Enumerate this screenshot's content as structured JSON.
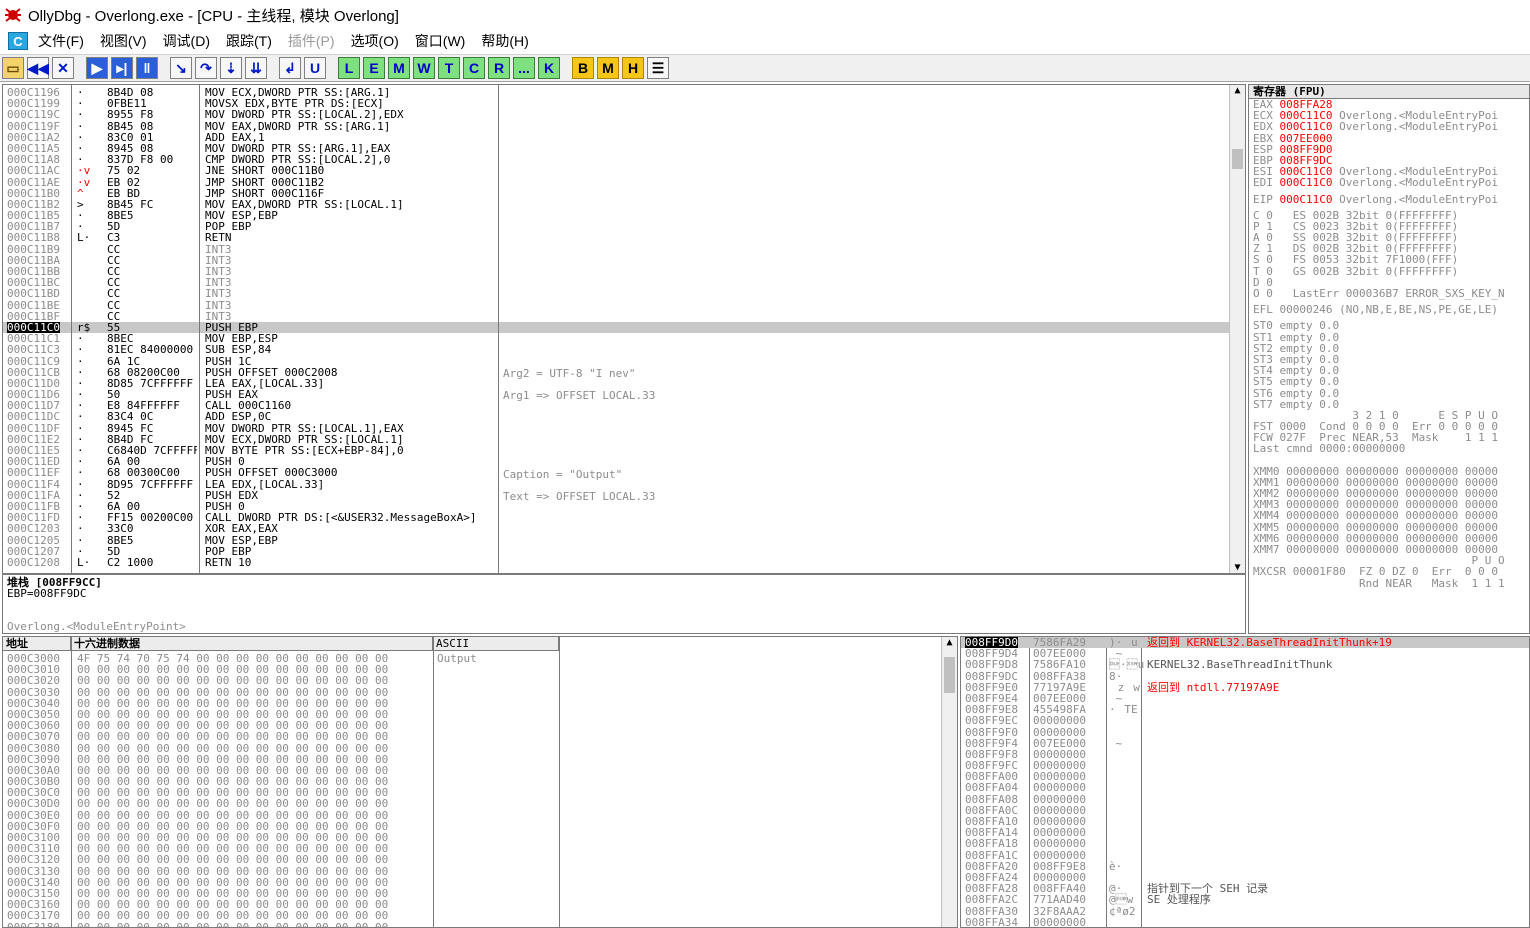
{
  "window": {
    "title": "OllyDbg - Overlong.exe - [CPU - 主线程, 模块 Overlong]"
  },
  "menu": {
    "cpu_icon": "C",
    "items": [
      {
        "label": "文件(F)",
        "enabled": true
      },
      {
        "label": "视图(V)",
        "enabled": true
      },
      {
        "label": "调试(D)",
        "enabled": true
      },
      {
        "label": "跟踪(T)",
        "enabled": true
      },
      {
        "label": "插件(P)",
        "enabled": false
      },
      {
        "label": "选项(O)",
        "enabled": true
      },
      {
        "label": "窗口(W)",
        "enabled": true
      },
      {
        "label": "帮助(H)",
        "enabled": true
      }
    ]
  },
  "toolbar": {
    "icons": [
      "open-icon",
      "restart-icon",
      "close-icon",
      "run-icon",
      "step-icon",
      "pause-icon",
      "step-into-icon",
      "step-over-icon",
      "trace-into-icon",
      "trace-over-icon",
      "execute-till-return-icon",
      "execute-till-user-code-icon"
    ],
    "letters": [
      "L",
      "E",
      "M",
      "W",
      "T",
      "C",
      "R",
      "...",
      "K"
    ],
    "letters2": [
      "B",
      "M",
      "H"
    ]
  },
  "disasm": {
    "addr": [
      "000C1196",
      "000C1199",
      "000C119C",
      "000C119F",
      "000C11A2",
      "000C11A5",
      "000C11A8",
      "000C11AC",
      "000C11AE",
      "000C11B0",
      "000C11B2",
      "000C11B5",
      "000C11B7",
      "000C11B8",
      "000C11B9",
      "000C11BA",
      "000C11BB",
      "000C11BC",
      "000C11BD",
      "000C11BE",
      "000C11BF",
      "000C11C0",
      "000C11C1",
      "000C11C3",
      "000C11C9",
      "000C11CB",
      "000C11D0",
      "000C11D6",
      "000C11D7",
      "000C11DC",
      "000C11DF",
      "000C11E2",
      "000C11E5",
      "000C11ED",
      "000C11EF",
      "000C11F4",
      "000C11FA",
      "000C11FB",
      "000C11FD",
      "000C1203",
      "000C1205",
      "000C1207",
      "000C1208"
    ],
    "marks": [
      "·",
      "·",
      "·",
      "·",
      "·",
      "·",
      "·",
      "·v",
      "·v",
      "^",
      "> ",
      "·",
      "·",
      "L·",
      "",
      "",
      "",
      "",
      "",
      "",
      "",
      "r$",
      "·",
      "·",
      "·",
      "·",
      "·",
      "·",
      "·",
      "·",
      "·",
      "·",
      "·",
      "·",
      "·",
      "·",
      "·",
      "·",
      "·",
      "·",
      "·",
      "·",
      "L·"
    ],
    "hex": [
      "8B4D 08",
      "0FBE11",
      "8955 F8",
      "8B45 08",
      "83C0 01",
      "8945 08",
      "837D F8 00",
      "75 02",
      "EB 02",
      "EB BD",
      "8B45 FC",
      "8BE5",
      "5D",
      "C3",
      "CC",
      "CC",
      "CC",
      "CC",
      "CC",
      "CC",
      "CC",
      "55",
      "8BEC",
      "81EC 84000000",
      "6A 1C",
      "68 08200C00",
      "8D85 7CFFFFFF",
      "50",
      "E8 84FFFFFF",
      "83C4 0C",
      "8945 FC",
      "8B4D FC",
      "C6840D 7CFFFFFF",
      "6A 00",
      "68 00300C00",
      "8D95 7CFFFFFF",
      "52",
      "6A 00",
      "FF15 00200C00",
      "33C0",
      "8BE5",
      "5D",
      "C2 1000"
    ],
    "asm": [
      "MOV ECX,DWORD PTR SS:[ARG.1]",
      "MOVSX EDX,BYTE PTR DS:[ECX]",
      "MOV DWORD PTR SS:[LOCAL.2],EDX",
      "MOV EAX,DWORD PTR SS:[ARG.1]",
      "ADD EAX,1",
      "MOV DWORD PTR SS:[ARG.1],EAX",
      "CMP DWORD PTR SS:[LOCAL.2],0",
      "JNE SHORT 000C11B0",
      "JMP SHORT 000C11B2",
      "JMP SHORT 000C116F",
      "MOV EAX,DWORD PTR SS:[LOCAL.1]",
      "MOV ESP,EBP",
      "POP EBP",
      "RETN",
      "INT3",
      "INT3",
      "INT3",
      "INT3",
      "INT3",
      "INT3",
      "INT3",
      "PUSH EBP",
      "MOV EBP,ESP",
      "SUB ESP,84",
      "PUSH 1C",
      "PUSH OFFSET 000C2008",
      "LEA EAX,[LOCAL.33]",
      "PUSH EAX",
      "CALL 000C1160",
      "ADD ESP,0C",
      "MOV DWORD PTR SS:[LOCAL.1],EAX",
      "MOV ECX,DWORD PTR SS:[LOCAL.1]",
      "MOV BYTE PTR SS:[ECX+EBP-84],0",
      "PUSH 0",
      "PUSH OFFSET 000C3000",
      "LEA EDX,[LOCAL.33]",
      "PUSH EDX",
      "PUSH 0",
      "CALL DWORD PTR DS:[<&USER32.MessageBoxA>]",
      "XOR EAX,EAX",
      "MOV ESP,EBP",
      "POP EBP",
      "RETN 10"
    ],
    "comments": {
      "arg2": "Arg2 = UTF-8 \"I nev\"",
      "arg1": "Arg1 => OFFSET LOCAL.33",
      "caption": "Caption = \"Output\"",
      "text": "Text => OFFSET LOCAL.33"
    }
  },
  "info": {
    "line1": "堆栈 [008FF9CC]",
    "line2": "EBP=008FF9DC",
    "line3": "Overlong.<ModuleEntryPoint>"
  },
  "registers": {
    "header": "寄存器 (FPU)",
    "gpr": [
      {
        "n": "EAX",
        "v": "008FFA28",
        "c": ""
      },
      {
        "n": "ECX",
        "v": "000C11C0",
        "c": "Overlong.<ModuleEntryPoi"
      },
      {
        "n": "EDX",
        "v": "000C11C0",
        "c": "Overlong.<ModuleEntryPoi"
      },
      {
        "n": "EBX",
        "v": "007EE000",
        "c": ""
      },
      {
        "n": "ESP",
        "v": "008FF9D0",
        "c": ""
      },
      {
        "n": "EBP",
        "v": "008FF9DC",
        "c": ""
      },
      {
        "n": "ESI",
        "v": "000C11C0",
        "c": "Overlong.<ModuleEntryPoi"
      },
      {
        "n": "EDI",
        "v": "000C11C0",
        "c": "Overlong.<ModuleEntryPoi"
      }
    ],
    "eip": {
      "n": "EIP",
      "v": "000C11C0",
      "c": "Overlong.<ModuleEntryPoi"
    },
    "seg": [
      "C 0   ES 002B 32bit 0(FFFFFFFF)",
      "P 1   CS 0023 32bit 0(FFFFFFFF)",
      "A 0   SS 002B 32bit 0(FFFFFFFF)",
      "Z 1   DS 002B 32bit 0(FFFFFFFF)",
      "S 0   FS 0053 32bit 7F1000(FFF)",
      "T 0   GS 002B 32bit 0(FFFFFFFF)",
      "D 0",
      "O 0   LastErr 000036B7 ERROR_SXS_KEY_N"
    ],
    "efl": "EFL 00000246 (NO,NB,E,BE,NS,PE,GE,LE)",
    "st": [
      "ST0 empty 0.0",
      "ST1 empty 0.0",
      "ST2 empty 0.0",
      "ST3 empty 0.0",
      "ST4 empty 0.0",
      "ST5 empty 0.0",
      "ST6 empty 0.0",
      "ST7 empty 0.0"
    ],
    "fpu": [
      "               3 2 1 0      E S P U O",
      "FST 0000  Cond 0 0 0 0  Err 0 0 0 0 0",
      "FCW 027F  Prec NEAR,53  Mask    1 1 1",
      "Last cmnd 0000:00000000"
    ],
    "xmm": [
      "XMM0 00000000 00000000 00000000 00000",
      "XMM1 00000000 00000000 00000000 00000",
      "XMM2 00000000 00000000 00000000 00000",
      "XMM3 00000000 00000000 00000000 00000",
      "XMM4 00000000 00000000 00000000 00000",
      "XMM5 00000000 00000000 00000000 00000",
      "XMM6 00000000 00000000 00000000 00000",
      "XMM7 00000000 00000000 00000000 00000"
    ],
    "mxcsr": [
      "                                 P U O",
      "MXCSR 00001F80  FZ 0 DZ 0  Err  0 0 0",
      "                Rnd NEAR   Mask  1 1 1"
    ]
  },
  "dump": {
    "headers": {
      "addr": "地址",
      "hex": "十六进制数据",
      "ascii": "ASCII"
    },
    "rows": [
      "000C3000",
      "000C3010",
      "000C3020",
      "000C3030",
      "000C3040",
      "000C3050",
      "000C3060",
      "000C3070",
      "000C3080",
      "000C3090",
      "000C30A0",
      "000C30B0",
      "000C30C0",
      "000C30D0",
      "000C30E0",
      "000C30F0",
      "000C3100",
      "000C3110",
      "000C3120",
      "000C3130",
      "000C3140",
      "000C3150",
      "000C3160",
      "000C3170",
      "000C3180"
    ],
    "first_hex": "4F 75 74 70 75 74 00 00 00 00 00 00 00 00 00 00",
    "zero_hex": "00 00 00 00 00 00 00 00 00 00 00 00 00 00 00 00",
    "first_ascii": "Output"
  },
  "stack": {
    "addr": [
      "008FF9D0",
      "008FF9D4",
      "008FF9D8",
      "008FF9DC",
      "008FF9E0",
      "008FF9E4",
      "008FF9E8",
      "008FF9EC",
      "008FF9F0",
      "008FF9F4",
      "008FF9F8",
      "008FF9FC",
      "008FFA00",
      "008FFA04",
      "008FFA08",
      "008FFA0C",
      "008FFA10",
      "008FFA14",
      "008FFA18",
      "008FFA1C",
      "008FFA20",
      "008FFA24",
      "008FFA28",
      "008FFA2C",
      "008FFA30",
      "008FFA34"
    ],
    "val": [
      "7586FA29",
      "007EE000",
      "7586FA10",
      "008FFA38",
      "77197A9E",
      "007EE000",
      "455498FA",
      "00000000",
      "00000000",
      "007EE000",
      "00000000",
      "00000000",
      "00000000",
      "00000000",
      "00000000",
      "00000000",
      "00000000",
      "00000000",
      "00000000",
      "00000000",
      "008FF9E8",
      "00000000",
      "008FFA40",
      "771AAD40",
      "32F8AAA2",
      "00000000"
    ],
    "asc": [
      ")·u",
      " ~",
      "\u0010·u",
      "8·",
      "z\u0019w",
      " ~",
      "·TE",
      "",
      "",
      " ~",
      "",
      "",
      "",
      "",
      "",
      "",
      "",
      "",
      "",
      "",
      "è·",
      "",
      "@·",
      "@­\u001aw",
      "¢ªø2",
      ""
    ],
    "cmt": [
      {
        "i": 0,
        "t": "返回到 KERNEL32.BaseThreadInitThunk+19",
        "red": true
      },
      {
        "i": 2,
        "t": "KERNEL32.BaseThreadInitThunk",
        "red": false
      },
      {
        "i": 4,
        "t": "返回到 ntdll.77197A9E",
        "red": true
      },
      {
        "i": 22,
        "t": "指针到下一个 SEH 记录",
        "red": false
      },
      {
        "i": 23,
        "t": "SE 处理程序",
        "red": false
      }
    ]
  }
}
